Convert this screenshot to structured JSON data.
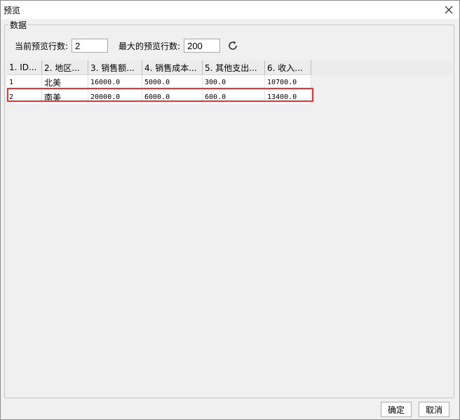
{
  "window": {
    "title": "预览"
  },
  "group": {
    "legend": "数据"
  },
  "controls": {
    "current_rows_label": "当前预览行数:",
    "current_rows_value": "2",
    "max_rows_label": "最大的预览行数:",
    "max_rows_value": "200"
  },
  "table": {
    "columns": [
      "1. ID...",
      "2. 地区...",
      "3. 销售额...",
      "4. 销售成本...",
      "5. 其他支出...",
      "6. 收入..."
    ],
    "rows": [
      [
        "1",
        "北美",
        "16000.0",
        "5000.0",
        "300.0",
        "10700.0"
      ],
      [
        "2",
        "南美",
        "20000.0",
        "6000.0",
        "600.0",
        "13400.0"
      ]
    ],
    "selected_row": 2
  },
  "buttons": {
    "ok": "确定",
    "cancel": "取消"
  },
  "colors": {
    "selection": "#e0363c"
  }
}
